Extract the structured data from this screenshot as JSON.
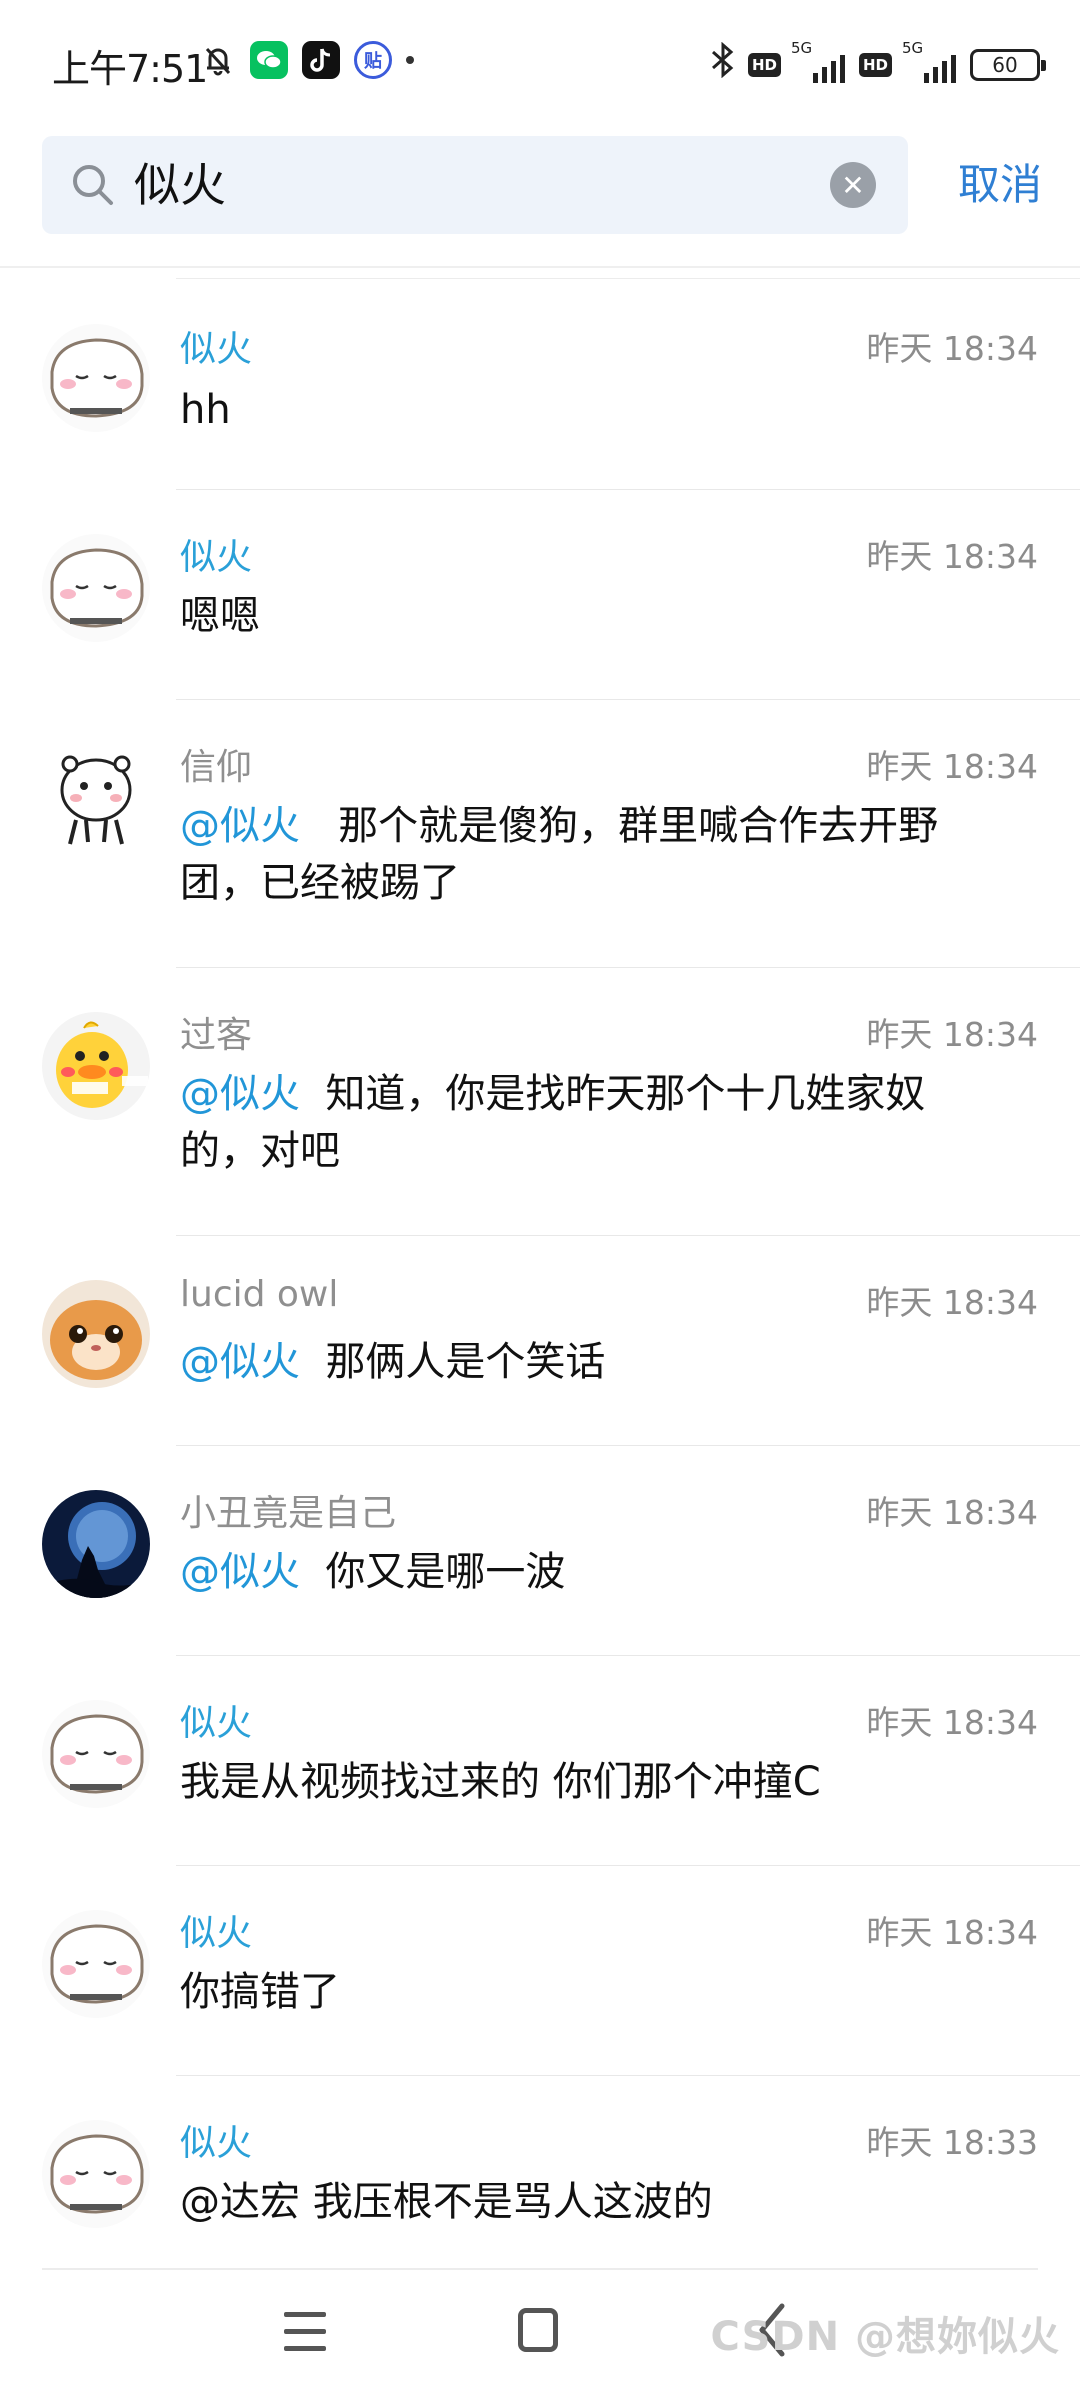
{
  "status_bar": {
    "time": "上午7:51",
    "left_icons": [
      "bell-off-icon",
      "wechat-icon",
      "tiktok-icon",
      "tieba-icon"
    ],
    "network_1": "5G",
    "network_2": "5G",
    "hd_1": "HD",
    "hd_2": "HD",
    "battery": "60"
  },
  "search": {
    "query": "似火",
    "cancel_label": "取消"
  },
  "results": [
    {
      "name": "似火",
      "time": "昨天 18:34",
      "mention": "",
      "text": "hh",
      "avatar": "cat-avatar",
      "name_style": "highlight"
    },
    {
      "name": "似火",
      "time": "昨天 18:34",
      "mention": "",
      "text": "嗯嗯",
      "avatar": "cat-avatar",
      "name_style": "highlight"
    },
    {
      "name": "信仰",
      "time": "昨天 18:34",
      "mention": "@似火",
      "text": "那个就是傻狗，群里喊合作去开野团，已经被踢了",
      "avatar": "bear-avatar",
      "name_style": "gray"
    },
    {
      "name": "过客",
      "time": "昨天 18:34",
      "mention": "@似火",
      "text": "知道，你是找昨天那个十几姓家奴的，对吧",
      "avatar": "duck-avatar",
      "name_style": "gray"
    },
    {
      "name": "lucid owl",
      "time": "昨天 18:34",
      "mention": "@似火",
      "text": "那俩人是个笑话",
      "avatar": "orange-cat-avatar",
      "name_style": "gray"
    },
    {
      "name": "小丑竟是自己",
      "time": "昨天 18:34",
      "mention": "@似火",
      "text": "你又是哪一波",
      "avatar": "wolf-moon-avatar",
      "name_style": "gray"
    },
    {
      "name": "似火",
      "time": "昨天 18:34",
      "mention": "",
      "text": "我是从视频找过来的 你们那个冲撞C",
      "avatar": "cat-avatar",
      "name_style": "highlight"
    },
    {
      "name": "似火",
      "time": "昨天 18:34",
      "mention": "",
      "text": "你搞错了",
      "avatar": "cat-avatar",
      "name_style": "highlight"
    },
    {
      "name": "似火",
      "time": "昨天 18:33",
      "mention": "",
      "text": "@达宏 我压根不是骂人这波的",
      "avatar": "cat-avatar",
      "name_style": "highlight"
    }
  ],
  "watermark": "CSDN @想妳似火",
  "colors": {
    "accent": "#2f7fd3",
    "mention": "#2196d8",
    "name_highlight": "#2aa0d8",
    "time": "#8c8c8c",
    "search_bg": "#eef3fa"
  }
}
